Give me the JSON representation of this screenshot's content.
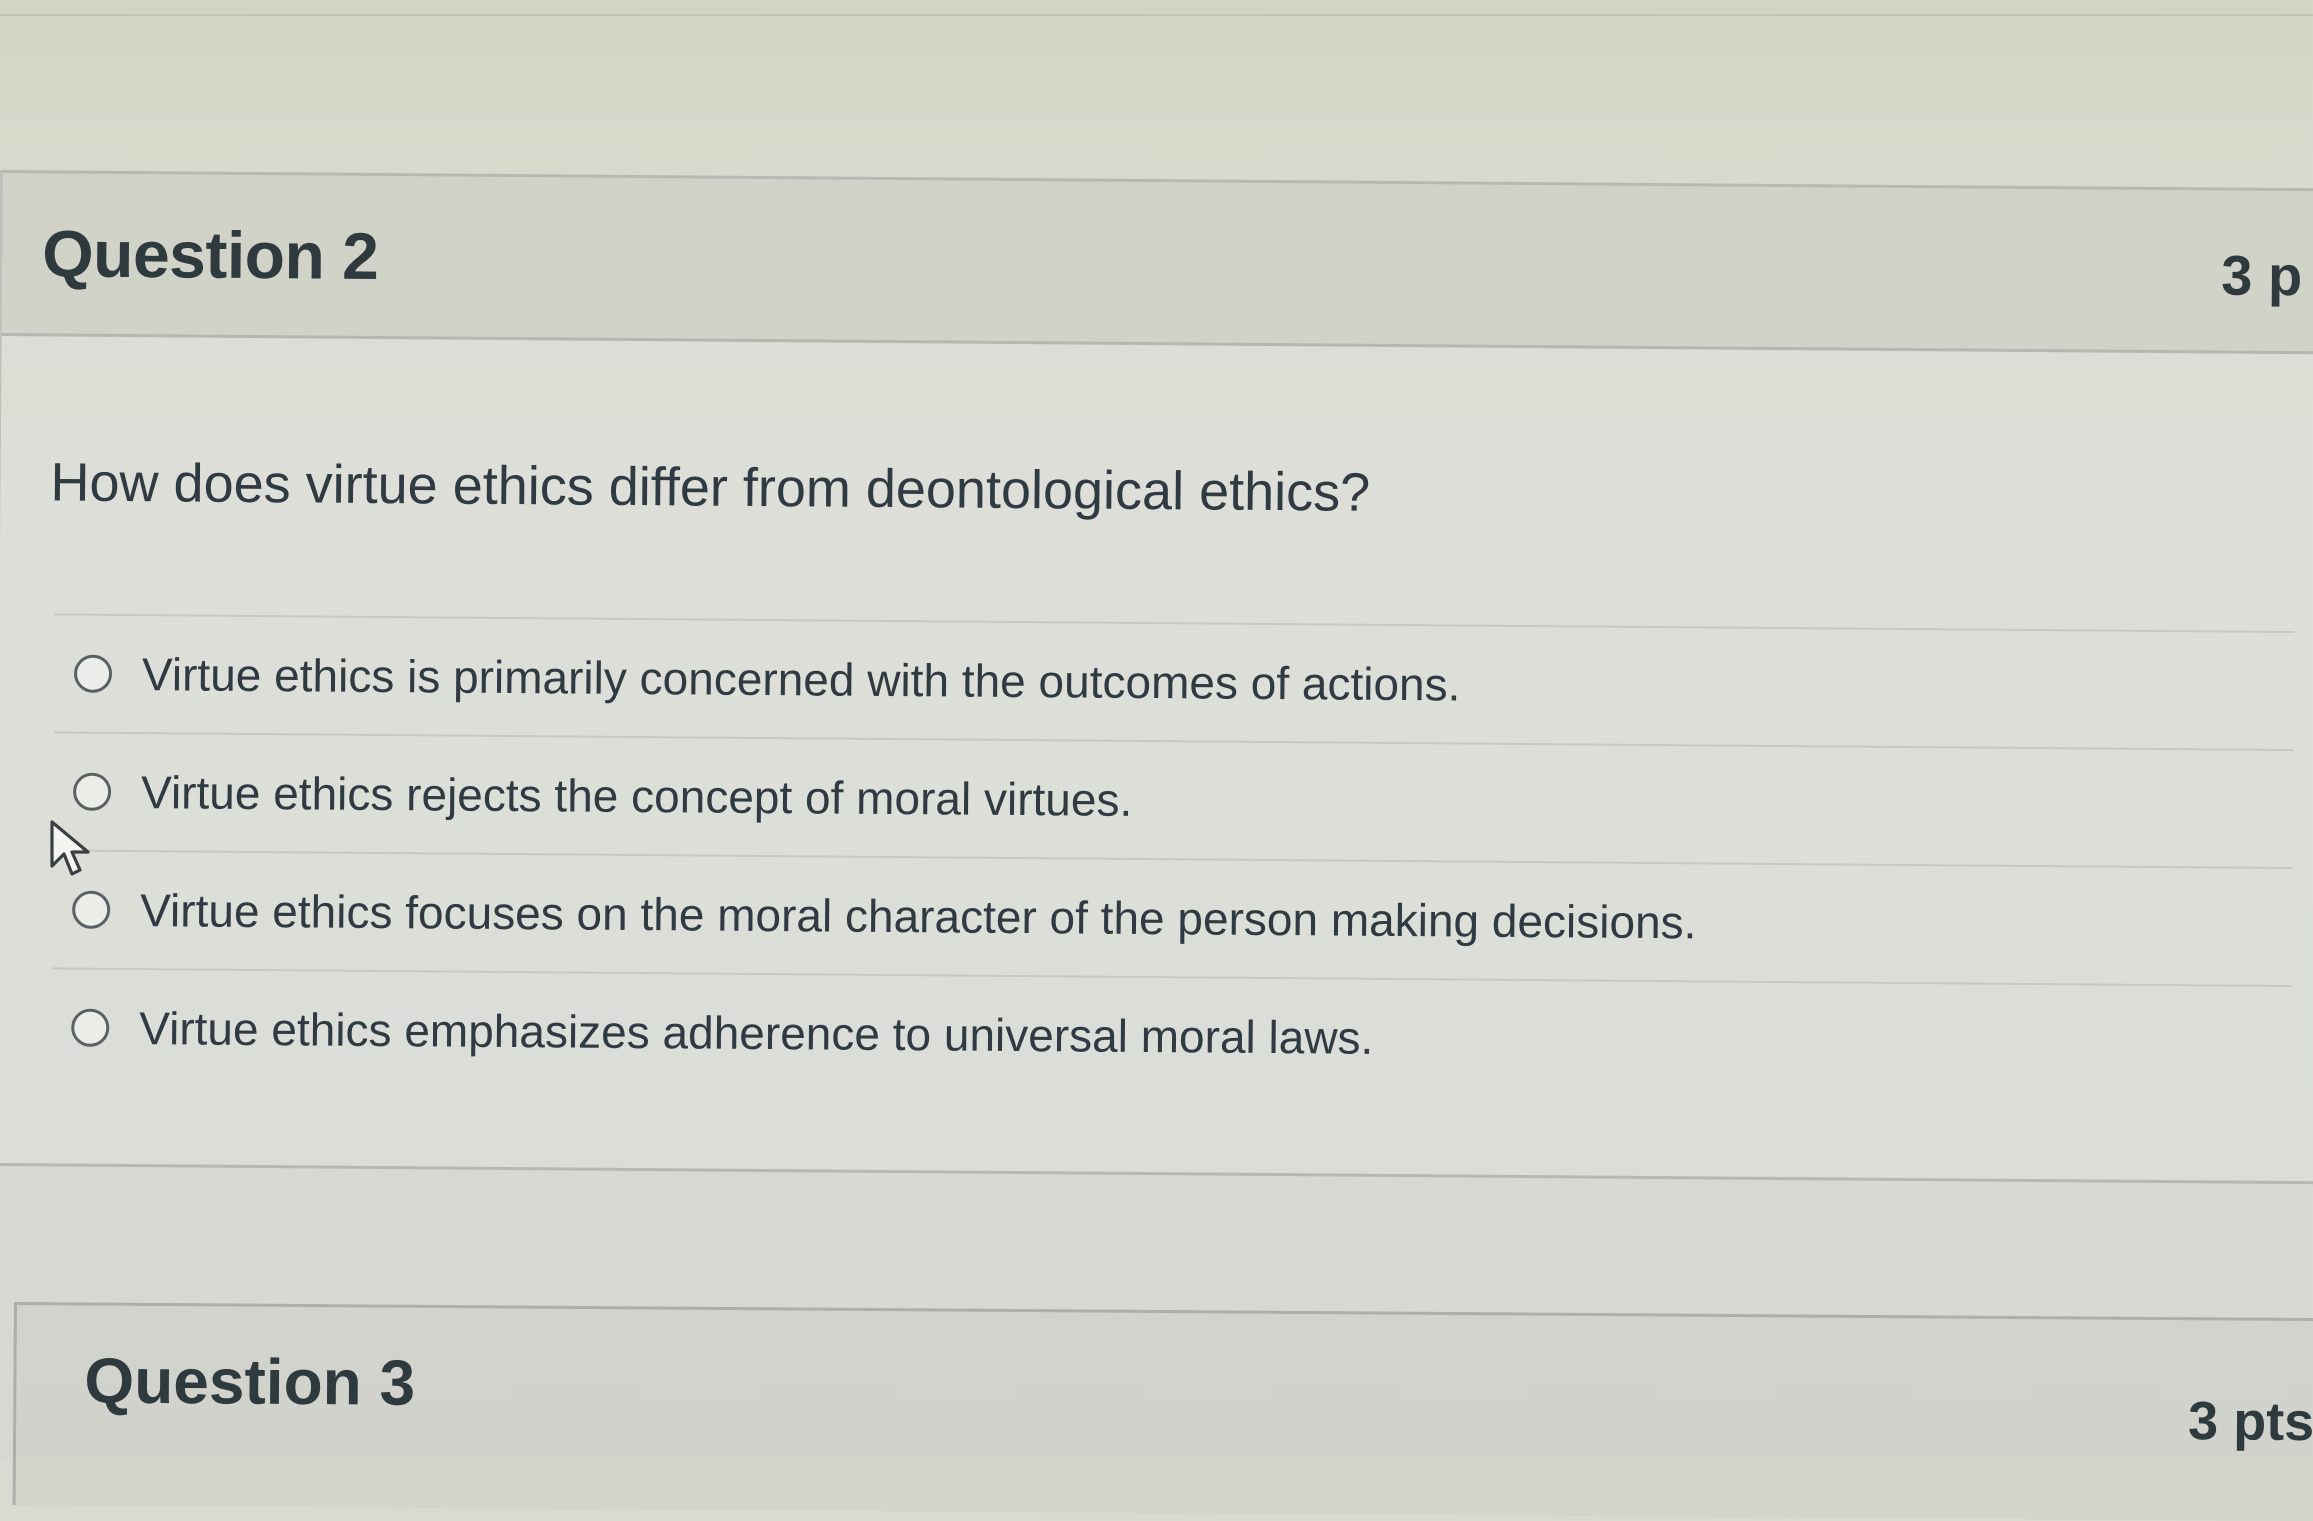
{
  "question2": {
    "title": "Question 2",
    "points": "3 p",
    "text": "How does virtue ethics differ from deontological ethics?",
    "options": [
      "Virtue ethics is primarily concerned with the outcomes of actions.",
      "Virtue ethics rejects the concept of moral virtues.",
      "Virtue ethics focuses on the moral character of the person making decisions.",
      "Virtue ethics emphasizes adherence to universal moral laws."
    ],
    "selected": null
  },
  "question3": {
    "title": "Question 3",
    "points": "3 pts"
  },
  "icons": {
    "radio": "radio-unselected-icon",
    "cursor": "mouse-pointer-icon"
  }
}
